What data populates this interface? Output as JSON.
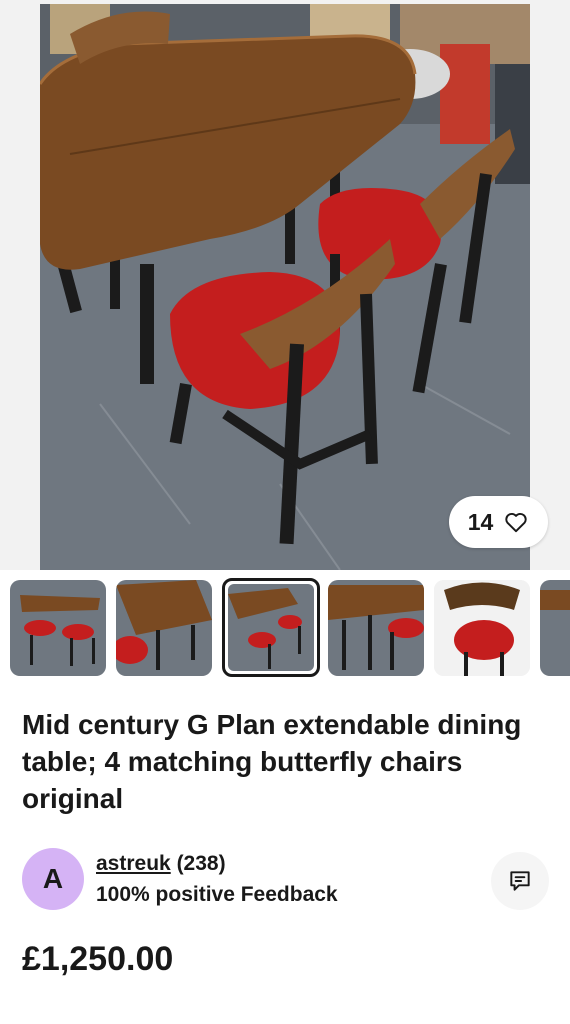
{
  "listing": {
    "watch_count": "14",
    "title": "Mid century G Plan extendable dining table; 4 matching butterfly chairs original",
    "price": "£1,250.00"
  },
  "seller": {
    "avatar_initial": "A",
    "username": "astreuk",
    "feedback_count": "(238)",
    "feedback_text": "100% positive Feedback"
  },
  "gallery": {
    "thumbnails": [
      "photo-1",
      "photo-2",
      "photo-3",
      "photo-4",
      "photo-5",
      "photo-6"
    ],
    "selected_index": 2
  },
  "icons": {
    "watch": "heart-icon",
    "message": "chat-bubble-icon"
  },
  "colors": {
    "text": "#191919",
    "avatar_bg": "#d5b3f5",
    "chair_seat": "#c41e1e",
    "wood": "#7a4a22"
  }
}
